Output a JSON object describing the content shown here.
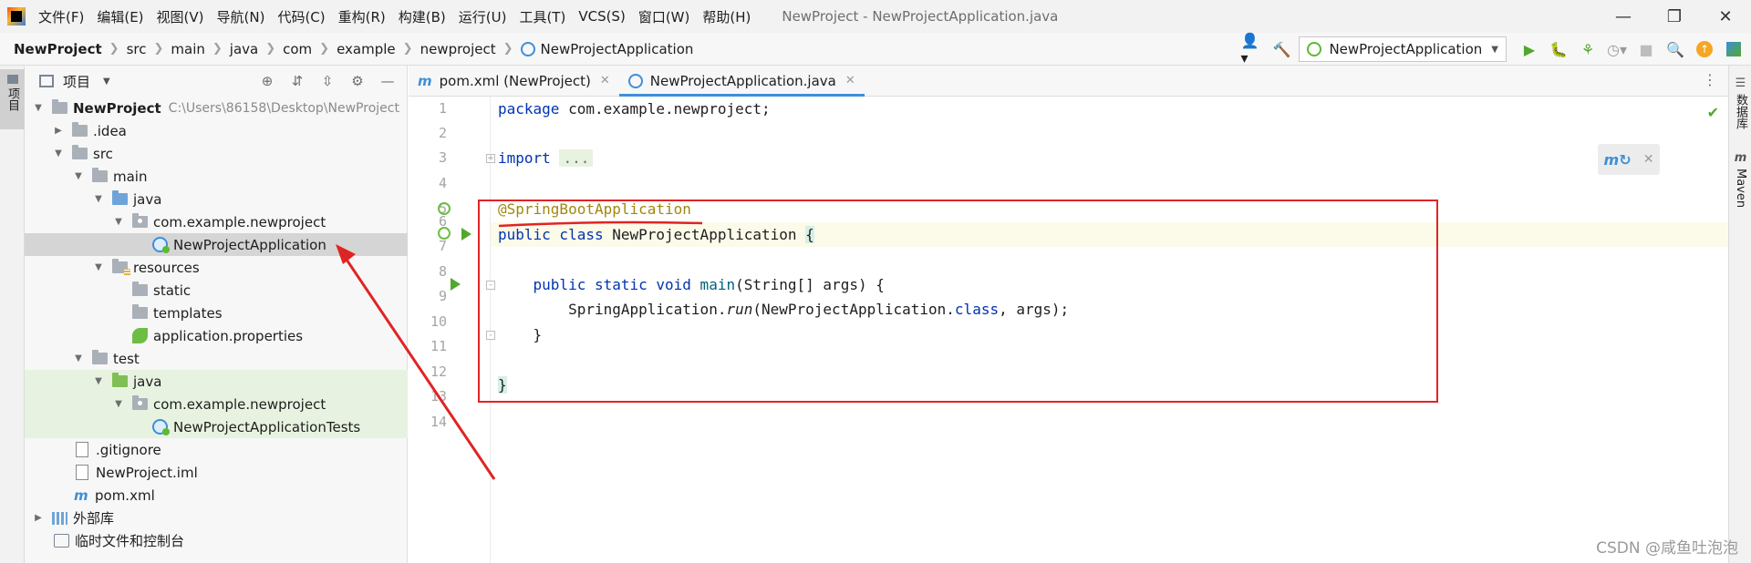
{
  "titlebar": {
    "menu": [
      "文件(F)",
      "编辑(E)",
      "视图(V)",
      "导航(N)",
      "代码(C)",
      "重构(R)",
      "构建(B)",
      "运行(U)",
      "工具(T)",
      "VCS(S)",
      "窗口(W)",
      "帮助(H)"
    ],
    "window_title": "NewProject - NewProjectApplication.java"
  },
  "navbar": {
    "crumbs": [
      "NewProject",
      "src",
      "main",
      "java",
      "com",
      "example",
      "newproject",
      "NewProjectApplication"
    ],
    "run_config": "NewProjectApplication"
  },
  "left_strip": {
    "project_tab": "项目"
  },
  "project_panel": {
    "title": "项目",
    "tree": [
      {
        "label": "NewProject",
        "path": "C:\\Users\\86158\\Desktop\\NewProject"
      },
      {
        "label": ".idea"
      },
      {
        "label": "src"
      },
      {
        "label": "main"
      },
      {
        "label": "java"
      },
      {
        "label": "com.example.newproject"
      },
      {
        "label": "NewProjectApplication"
      },
      {
        "label": "resources"
      },
      {
        "label": "static"
      },
      {
        "label": "templates"
      },
      {
        "label": "application.properties"
      },
      {
        "label": "test"
      },
      {
        "label": "java"
      },
      {
        "label": "com.example.newproject"
      },
      {
        "label": "NewProjectApplicationTests"
      },
      {
        "label": ".gitignore"
      },
      {
        "label": "NewProject.iml"
      },
      {
        "label": "pom.xml"
      },
      {
        "label": "外部库"
      },
      {
        "label": "临时文件和控制台"
      }
    ]
  },
  "editor_tabs": [
    {
      "label": "pom.xml (NewProject)",
      "active": false
    },
    {
      "label": "NewProjectApplication.java",
      "active": true
    }
  ],
  "editor": {
    "line_numbers": [
      "1",
      "2",
      "3",
      "4",
      "5",
      "6",
      "7",
      "8",
      "9",
      "10",
      "11",
      "12",
      "13",
      "14"
    ],
    "code": {
      "l1_kw": "package",
      "l1_rest": " com.example.newproject;",
      "l3_kw": "import",
      "l3_fold": "...",
      "l6_ann": "@SpringBootApplication",
      "l7_kw": "public class",
      "l7_name": " NewProjectApplication ",
      "l7_brace": "{",
      "l9_kw": "    public static void",
      "l9_fn": " main",
      "l9_rest": "(String[] args) {",
      "l10_a": "        SpringApplication.",
      "l10_run": "run",
      "l10_b": "(NewProjectApplication.",
      "l10_cls": "class",
      "l10_c": ", args);",
      "l11": "    }",
      "l13": "}"
    }
  },
  "right_strip": {
    "database_tab": "数据库",
    "maven_tab": "Maven"
  },
  "watermark": "CSDN @咸鱼吐泡泡",
  "colors": {
    "annotation_box": "#e02424",
    "accent": "#3d8fd8",
    "run_green": "#52a82e"
  }
}
